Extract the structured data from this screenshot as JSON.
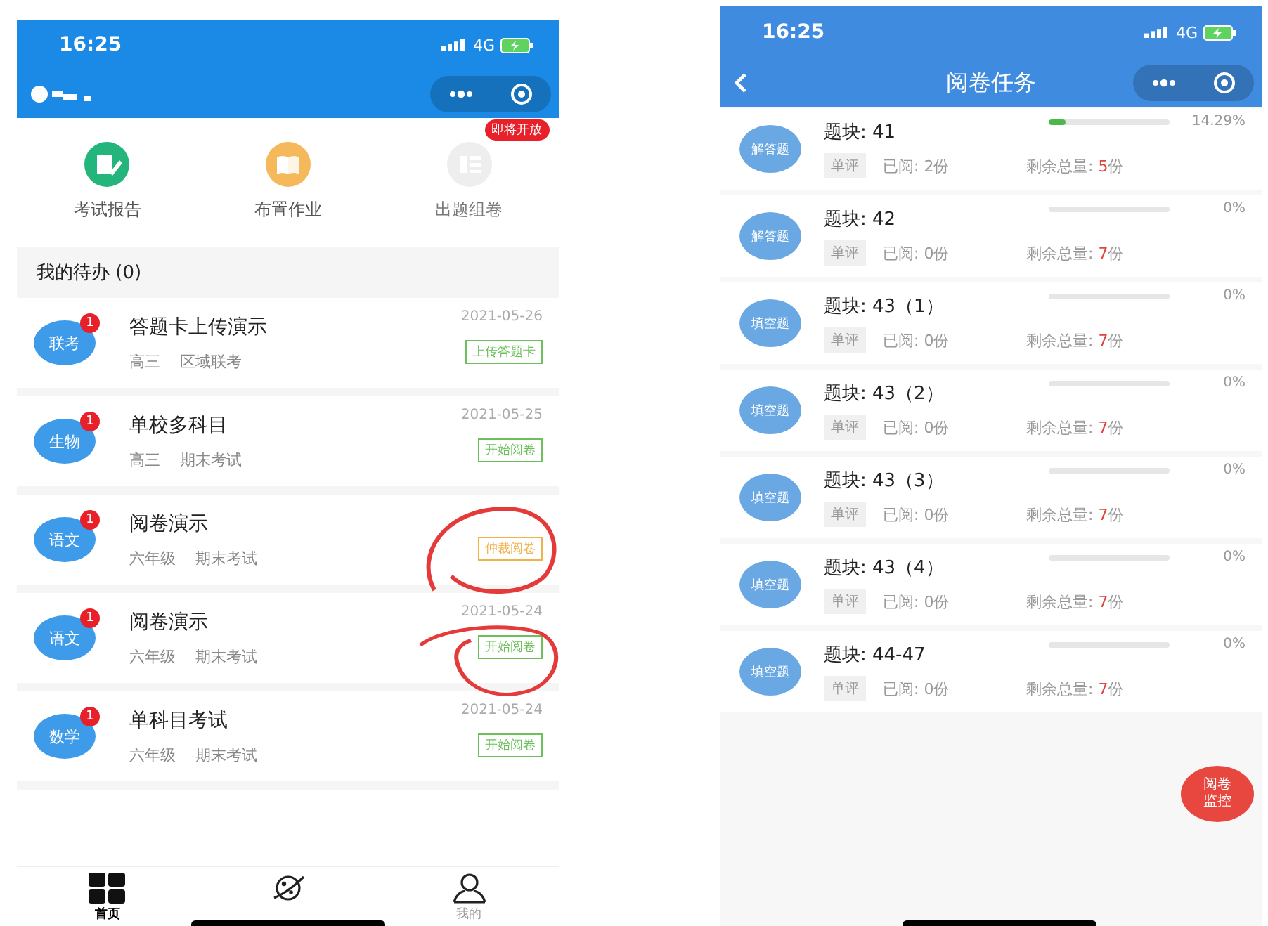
{
  "left_screen": {
    "status_bar": {
      "time": "16:25",
      "network": "4G"
    },
    "shortcuts": [
      {
        "kind": "report",
        "label": "考试报告",
        "disabled": false
      },
      {
        "kind": "homework",
        "label": "布置作业",
        "disabled": false
      },
      {
        "kind": "compose",
        "label": "出题组卷",
        "disabled": true,
        "badge": "即将开放"
      }
    ],
    "todo_header": "我的待办 (0)",
    "todos": [
      {
        "subject": "联考",
        "badge": "1",
        "title": "答题卡上传演示",
        "grade": "高三",
        "exam_type": "区域联考",
        "date": "2021-05-26",
        "action": "上传答题卡",
        "color": "#6cbf5a"
      },
      {
        "subject": "生物",
        "badge": "1",
        "title": "单校多科目",
        "grade": "高三",
        "exam_type": "期末考试",
        "date": "2021-05-25",
        "action": "开始阅卷",
        "color": "#6cbf5a"
      },
      {
        "subject": "语文",
        "badge": "1",
        "title": "阅卷演示",
        "grade": "六年级",
        "exam_type": "期末考试",
        "action": "仲裁阅卷",
        "color": "#f0b24a"
      },
      {
        "subject": "语文",
        "badge": "1",
        "title": "阅卷演示",
        "grade": "六年级",
        "exam_type": "期末考试",
        "date": "2021-05-24",
        "action": "开始阅卷",
        "color": "#6cbf5a"
      },
      {
        "subject": "数学",
        "badge": "1",
        "title": "单科目考试",
        "grade": "六年级",
        "exam_type": "期末考试",
        "date": "2021-05-24",
        "action": "开始阅卷",
        "color": "#6cbf5a"
      }
    ],
    "nav": [
      {
        "kind": "home",
        "label": "首页",
        "selected": true
      },
      {
        "kind": "planet"
      },
      {
        "kind": "profile",
        "label": "我的",
        "selected": false
      }
    ]
  },
  "right_screen": {
    "status_bar": {
      "time": "16:25",
      "network": "4G"
    },
    "title": "阅卷任务",
    "tasks": [
      {
        "type": "解答题",
        "title": "题块: 41",
        "mode": "单评",
        "read": "已阅: 2份",
        "remaining_label": "剩余总量: ",
        "remaining": "5",
        "unit": "份",
        "level": 0.1429,
        "percent": "14.29%"
      },
      {
        "type": "解答题",
        "title": "题块: 42",
        "mode": "单评",
        "read": "已阅: 0份",
        "remaining_label": "剩余总量: ",
        "remaining": "7",
        "unit": "份",
        "level": 0,
        "percent": "0%"
      },
      {
        "type": "填空题",
        "title": "题块: 43（1）",
        "mode": "单评",
        "read": "已阅: 0份",
        "remaining_label": "剩余总量: ",
        "remaining": "7",
        "unit": "份",
        "level": 0,
        "percent": "0%"
      },
      {
        "type": "填空题",
        "title": "题块: 43（2）",
        "mode": "单评",
        "read": "已阅: 0份",
        "remaining_label": "剩余总量: ",
        "remaining": "7",
        "unit": "份",
        "level": 0,
        "percent": "0%"
      },
      {
        "type": "填空题",
        "title": "题块: 43（3）",
        "mode": "单评",
        "read": "已阅: 0份",
        "remaining_label": "剩余总量: ",
        "remaining": "7",
        "unit": "份",
        "level": 0,
        "percent": "0%"
      },
      {
        "type": "填空题",
        "title": "题块: 43（4）",
        "mode": "单评",
        "read": "已阅: 0份",
        "remaining_label": "剩余总量: ",
        "remaining": "7",
        "unit": "份",
        "level": 0,
        "percent": "0%"
      },
      {
        "type": "填空题",
        "title": "题块: 44-47",
        "mode": "单评",
        "read": "已阅: 0份",
        "remaining_label": "剩余总量: ",
        "remaining": "7",
        "unit": "份",
        "level": 0,
        "percent": "0%"
      }
    ],
    "monitor_button": "阅卷监控"
  }
}
